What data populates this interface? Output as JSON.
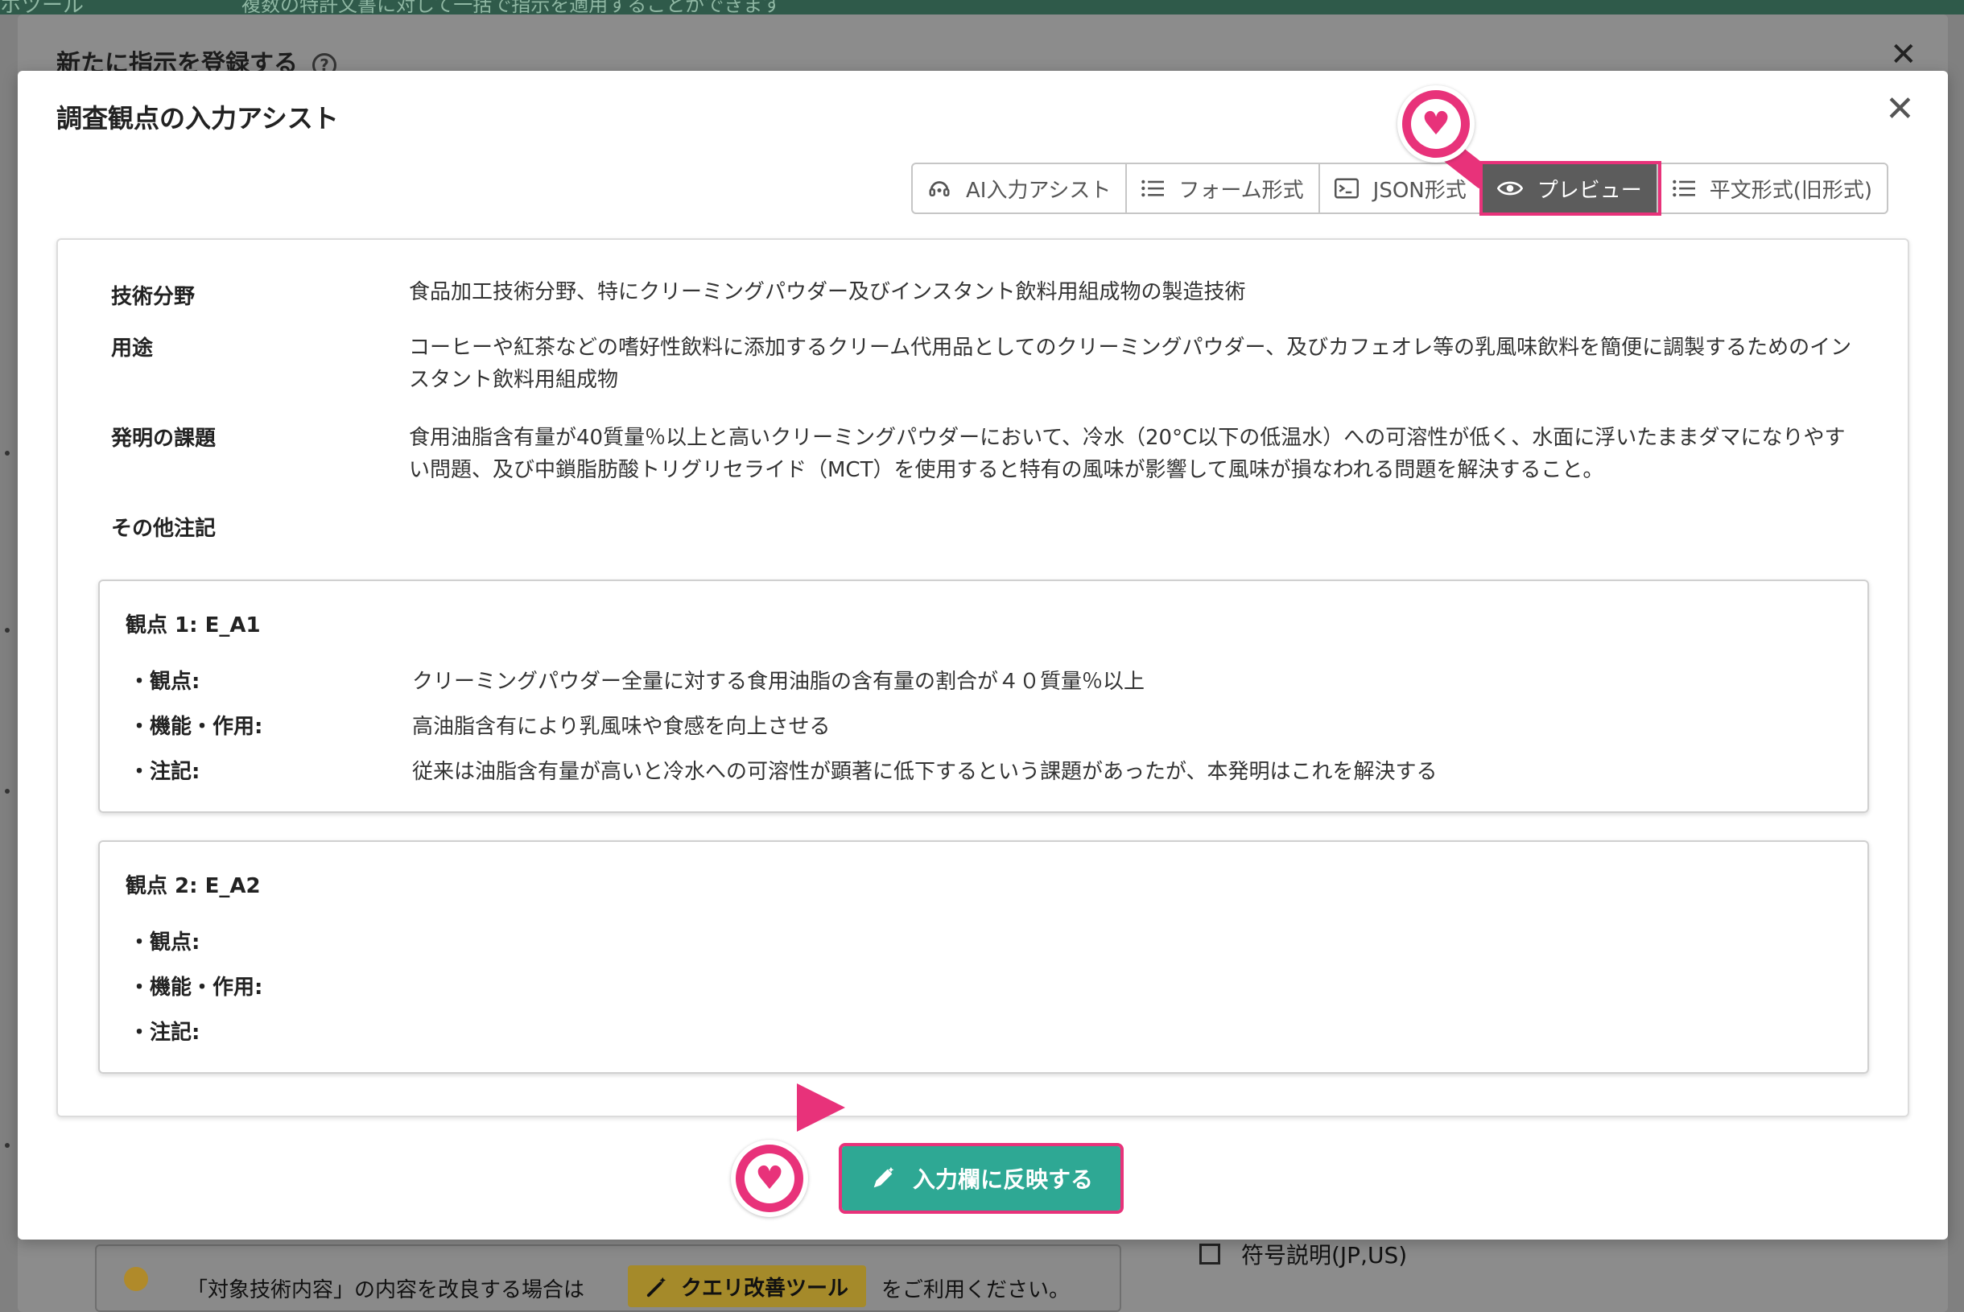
{
  "background": {
    "topbar_text": "ホツール",
    "topbar_text2": "複数の特許文書に対して一括で指示を適用することができます",
    "dialog_title": "新たに指示を登録する",
    "help_icon": "question-circle-icon",
    "hint_text_before": "「対象技術内容」の内容を改良する場合は",
    "query_button_label": "クエリ改善ツール",
    "hint_text_after": "をご利用ください。",
    "checkbox_label": "符号説明(JP,US)"
  },
  "modal": {
    "title": "調査観点の入力アシスト",
    "close_icon": "close-icon"
  },
  "tabs": [
    {
      "label": "AI入力アシスト",
      "icon": "ai-assistant-icon"
    },
    {
      "label": "フォーム形式",
      "icon": "list-icon"
    },
    {
      "label": "JSON形式",
      "icon": "terminal-icon"
    },
    {
      "label": "プレビュー",
      "icon": "eye-icon",
      "active": true
    },
    {
      "label": "平文形式(旧形式)",
      "icon": "list-icon"
    }
  ],
  "fields": {
    "tech_field": {
      "label": "技術分野",
      "value": "食品加工技術分野、特にクリーミングパウダー及びインスタント飲料用組成物の製造技術"
    },
    "use": {
      "label": "用途",
      "value": "コーヒーや紅茶などの嗜好性飲料に添加するクリーム代用品としてのクリーミングパウダー、及びカフェオレ等の乳風味飲料を簡便に調製するためのインスタント飲料用組成物"
    },
    "problem": {
      "label": "発明の課題",
      "value": "食用油脂含有量が40質量％以上と高いクリーミングパウダーにおいて、冷水（20°C以下の低温水）への可溶性が低く、水面に浮いたままダマになりやすい問題、及び中鎖脂肪酸トリグリセライド（MCT）を使用すると特有の風味が影響して風味が損なわれる問題を解決すること。"
    },
    "other": {
      "label": "その他注記",
      "value": ""
    }
  },
  "viewpoints": [
    {
      "title": "観点 1: E_A1",
      "viewpoint_label": "・観点:",
      "viewpoint_value": "クリーミングパウダー全量に対する食用油脂の含有量の割合が４０質量％以上",
      "function_label": "・機能・作用:",
      "function_value": "高油脂含有により乳風味や食感を向上させる",
      "note_label": "・注記:",
      "note_value": "従来は油脂含有量が高いと冷水への可溶性が顕著に低下するという課題があったが、本発明はこれを解決する"
    },
    {
      "title": "観点 2: E_A2",
      "viewpoint_label": "・観点:",
      "viewpoint_value": "",
      "function_label": "・機能・作用:",
      "function_value": "",
      "note_label": "・注記:",
      "note_value": ""
    }
  ],
  "apply_button": {
    "label": "入力欄に反映する",
    "icon": "pen-icon"
  },
  "markers": {
    "icon": "heart-icon",
    "color": "#e8327a"
  },
  "colors": {
    "accent_green": "#2ea894",
    "highlight_pink": "#e8327a",
    "active_tab": "#5c5c5c"
  }
}
